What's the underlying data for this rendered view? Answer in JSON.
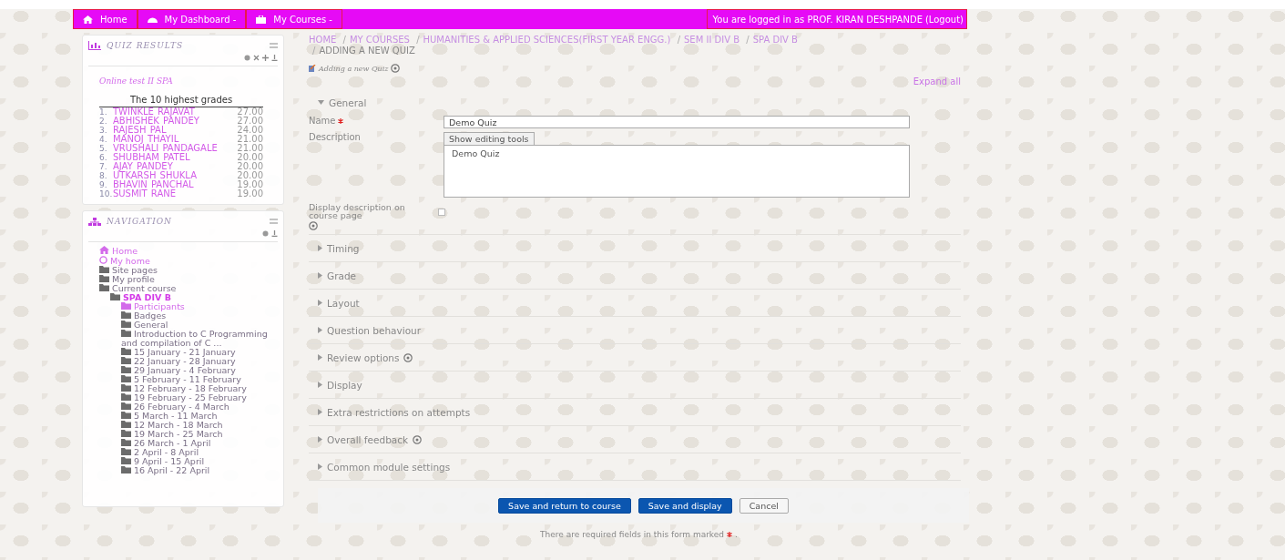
{
  "top_nav": {
    "items": [
      {
        "label": "Home"
      },
      {
        "label": "My Dashboard -"
      },
      {
        "label": "My Courses -"
      }
    ],
    "login_text": "You are logged in as PROF. KIRAN DESHPANDE",
    "logout": "(Logout)"
  },
  "quiz_block": {
    "title": "QUIZ RESULTS",
    "quiz_link": "Online test II SPA",
    "table_heading": "The 10 highest grades",
    "rows": [
      {
        "rank": "1.",
        "name": "TWINKLE RAJAVAT",
        "grade": "27.00"
      },
      {
        "rank": "2.",
        "name": "ABHISHEK PANDEY",
        "grade": "27.00"
      },
      {
        "rank": "3.",
        "name": "RAJESH PAL",
        "grade": "24.00"
      },
      {
        "rank": "4.",
        "name": "MANOJ THAYIL",
        "grade": "21.00"
      },
      {
        "rank": "5.",
        "name": "VRUSHALI PANDAGALE",
        "grade": "21.00"
      },
      {
        "rank": "6.",
        "name": "SHUBHAM PATEL",
        "grade": "20.00"
      },
      {
        "rank": "7.",
        "name": "AJAY PANDEY",
        "grade": "20.00"
      },
      {
        "rank": "8.",
        "name": "UTKARSH SHUKLA",
        "grade": "20.00"
      },
      {
        "rank": "9.",
        "name": "BHAVIN PANCHAL",
        "grade": "19.00"
      },
      {
        "rank": "10.",
        "name": "SUSMIT RANE",
        "grade": "19.00"
      }
    ]
  },
  "navigation": {
    "title": "NAVIGATION",
    "items": [
      {
        "label": "Home",
        "kind": "house",
        "link": true,
        "selected": false
      },
      {
        "label": "My home",
        "kind": "circle",
        "link": true,
        "selected": false
      },
      {
        "label": "Site pages",
        "kind": "folder",
        "link": false,
        "selected": false
      },
      {
        "label": "My profile",
        "kind": "folder",
        "link": false,
        "selected": false
      },
      {
        "label": "Current course",
        "kind": "folder",
        "link": false,
        "selected": false,
        "children": [
          {
            "label": "SPA DIV B",
            "kind": "folder",
            "selected": true,
            "children": [
              {
                "label": "Participants",
                "kind": "folder",
                "link": true,
                "selected": false
              },
              {
                "label": "Badges",
                "kind": "folder",
                "link": false,
                "selected": false
              },
              {
                "label": "General",
                "kind": "folder",
                "link": false,
                "selected": false
              },
              {
                "label": "Introduction to C Programming and compilation of C ...",
                "kind": "folder",
                "link": false,
                "selected": false
              },
              {
                "label": "15 January - 21 January",
                "kind": "folder",
                "link": false,
                "selected": false
              },
              {
                "label": "22 January - 28 January",
                "kind": "folder",
                "link": false,
                "selected": false
              },
              {
                "label": "29 January - 4 February",
                "kind": "folder",
                "link": false,
                "selected": false
              },
              {
                "label": "5 February - 11 February",
                "kind": "folder",
                "link": false,
                "selected": false
              },
              {
                "label": "12 February - 18 February",
                "kind": "folder",
                "link": false,
                "selected": false
              },
              {
                "label": "19 February - 25 February",
                "kind": "folder",
                "link": false,
                "selected": false
              },
              {
                "label": "26 February - 4 March",
                "kind": "folder",
                "link": false,
                "selected": false
              },
              {
                "label": "5 March - 11 March",
                "kind": "folder",
                "link": false,
                "selected": false
              },
              {
                "label": "12 March - 18 March",
                "kind": "folder",
                "link": false,
                "selected": false
              },
              {
                "label": "19 March - 25 March",
                "kind": "folder",
                "link": false,
                "selected": false
              },
              {
                "label": "26 March - 1 April",
                "kind": "folder",
                "link": false,
                "selected": false
              },
              {
                "label": "2 April - 8 April",
                "kind": "folder",
                "link": false,
                "selected": false
              },
              {
                "label": "9 April - 15 April",
                "kind": "folder",
                "link": false,
                "selected": false
              },
              {
                "label": "16 April - 22 April",
                "kind": "folder",
                "link": false,
                "selected": false
              }
            ]
          }
        ]
      }
    ]
  },
  "breadcrumb": {
    "separator": "/",
    "items": [
      {
        "label": "HOME",
        "link": true
      },
      {
        "label": "MY COURSES",
        "link": true
      },
      {
        "label": "HUMANITIES & APPLIED SCIENCES(FIRST YEAR ENGG.)",
        "link": true
      },
      {
        "label": "SEM II DIV B",
        "link": true
      },
      {
        "label": "SPA DIV B",
        "link": true
      },
      {
        "label": "ADDING A NEW QUIZ",
        "link": false
      }
    ]
  },
  "heading": "Adding a new Quiz",
  "expand_all": "Expand all",
  "sections": [
    {
      "label": "General",
      "expanded": true,
      "help": false
    },
    {
      "label": "Timing",
      "expanded": false,
      "help": false
    },
    {
      "label": "Grade",
      "expanded": false,
      "help": false
    },
    {
      "label": "Layout",
      "expanded": false,
      "help": false
    },
    {
      "label": "Question behaviour",
      "expanded": false,
      "help": false
    },
    {
      "label": "Review options",
      "expanded": false,
      "help": true
    },
    {
      "label": "Display",
      "expanded": false,
      "help": false
    },
    {
      "label": "Extra restrictions on attempts",
      "expanded": false,
      "help": false
    },
    {
      "label": "Overall feedback",
      "expanded": false,
      "help": true
    },
    {
      "label": "Common module settings",
      "expanded": false,
      "help": false
    }
  ],
  "general": {
    "name_label": "Name",
    "name_required": true,
    "name_value": "Demo Quiz",
    "description_label": "Description",
    "editing_tools_tab": "Show editing tools",
    "description_value": "Demo Quiz",
    "display_label": "Display description on course page",
    "display_checked": false
  },
  "buttons": [
    {
      "label": "Save and return to course",
      "kind": "primary"
    },
    {
      "label": "Save and display",
      "kind": "primary"
    },
    {
      "label": "Cancel",
      "kind": "secondary"
    }
  ],
  "note": {
    "before": "There are required fields in this form marked",
    "after": "."
  }
}
